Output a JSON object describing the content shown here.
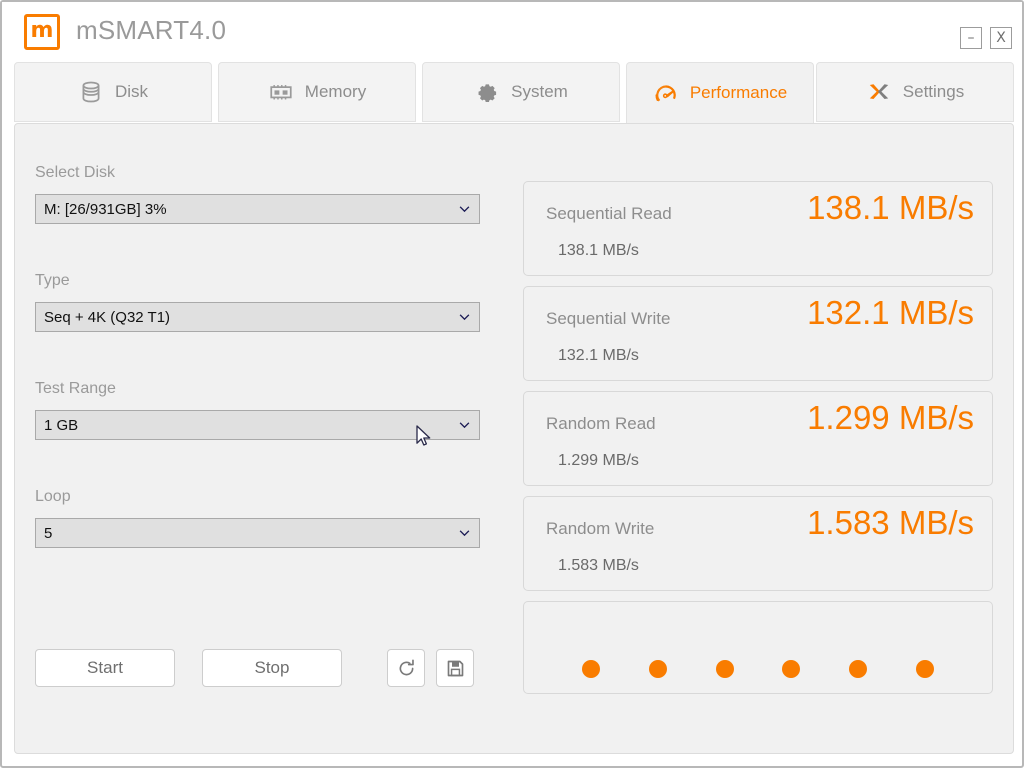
{
  "window": {
    "title": "mSMART4.0",
    "logo_letter": "m",
    "minimize_label": "–",
    "close_label": "X"
  },
  "tabs": [
    {
      "label": "Disk",
      "icon": "database-icon",
      "active": false
    },
    {
      "label": "Memory",
      "icon": "memory-chip-icon",
      "active": false
    },
    {
      "label": "System",
      "icon": "gear-icon",
      "active": false
    },
    {
      "label": "Performance",
      "icon": "gauge-icon",
      "active": true
    },
    {
      "label": "Settings",
      "icon": "wrench-icon",
      "active": false
    }
  ],
  "controls": {
    "select_disk": {
      "label": "Select Disk",
      "value": "M: [26/931GB] 3%"
    },
    "type": {
      "label": "Type",
      "value": "Seq + 4K (Q32 T1)"
    },
    "test_range": {
      "label": "Test Range",
      "value": "1 GB"
    },
    "loop": {
      "label": "Loop",
      "value": "5"
    }
  },
  "buttons": {
    "start": "Start",
    "stop": "Stop",
    "refresh_icon": "refresh-icon",
    "save_icon": "floppy-save-icon"
  },
  "results": [
    {
      "title": "Sequential Read",
      "value": "138.1 MB/s",
      "sub": "138.1 MB/s"
    },
    {
      "title": "Sequential Write",
      "value": "132.1 MB/s",
      "sub": "132.1 MB/s"
    },
    {
      "title": "Random Read",
      "value": "1.299 MB/s",
      "sub": "1.299 MB/s"
    },
    {
      "title": "Random Write",
      "value": "1.583 MB/s",
      "sub": "1.583 MB/s"
    }
  ],
  "progress": {
    "dot_count": 6,
    "dots_state": [
      "on",
      "on",
      "on",
      "on",
      "on",
      "on"
    ]
  },
  "colors": {
    "accent": "#f97c00",
    "panel": "#f1f1f1",
    "text_muted": "#8d8d8d",
    "border": "#d8d8d8"
  }
}
